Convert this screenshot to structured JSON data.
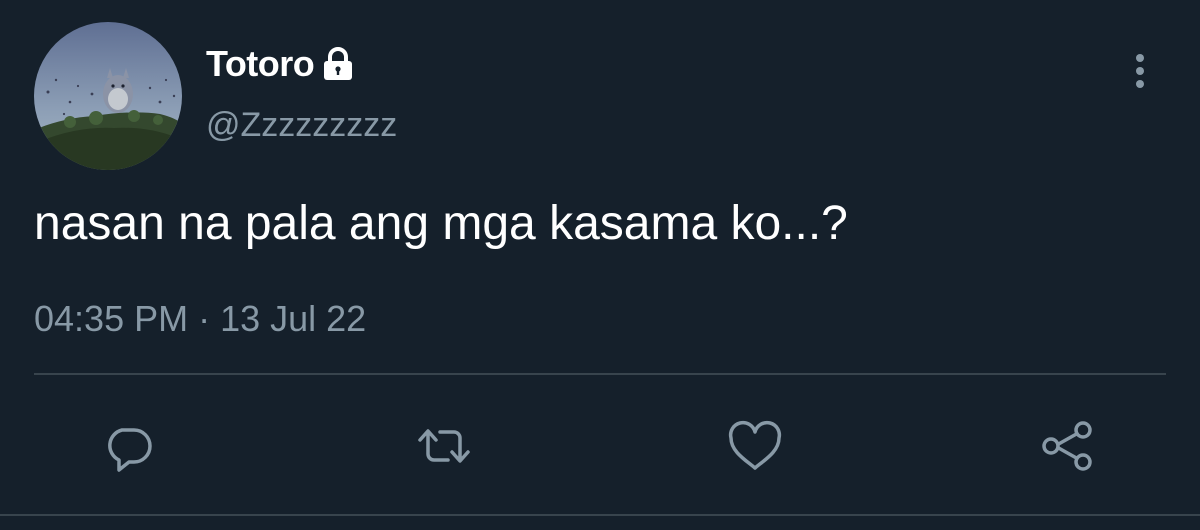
{
  "user": {
    "display_name": "Totoro",
    "handle": "@Zzzzzzzzz",
    "protected": true,
    "avatar_icon": "totoro-on-hill-avatar"
  },
  "tweet": {
    "text": "nasan na pala ang mga kasama ko...?",
    "timestamp": "04:35 PM · 13 Jul 22"
  },
  "actions": [
    {
      "icon": "reply-icon"
    },
    {
      "icon": "retweet-icon"
    },
    {
      "icon": "like-icon"
    },
    {
      "icon": "share-icon"
    }
  ],
  "colors": {
    "background": "#15202b",
    "primary_text": "#ffffff",
    "secondary_text": "#8899a6",
    "divider": "#38444d"
  }
}
